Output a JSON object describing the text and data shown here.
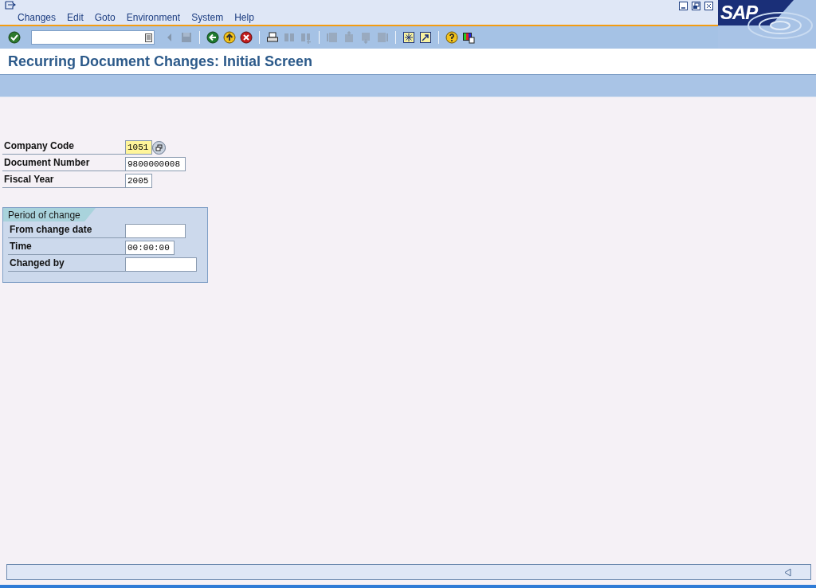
{
  "menu_bar": [
    "Changes",
    "Edit",
    "Goto",
    "Environment",
    "System",
    "Help"
  ],
  "logo": "SAP",
  "toolbar": {
    "groups": [
      [
        {
          "kind": "enter",
          "disabled": false
        }
      ],
      [
        {
          "kind": "prev",
          "disabled": true
        },
        {
          "kind": "save",
          "disabled": true
        }
      ],
      [
        {
          "kind": "back",
          "disabled": false
        },
        {
          "kind": "exit",
          "disabled": false
        },
        {
          "kind": "cancel",
          "disabled": false
        }
      ],
      [
        {
          "kind": "print",
          "disabled": false
        },
        {
          "kind": "find",
          "disabled": true
        },
        {
          "kind": "find-next",
          "disabled": true
        }
      ],
      [
        {
          "kind": "first-page",
          "disabled": true
        },
        {
          "kind": "prev-page",
          "disabled": true
        },
        {
          "kind": "next-page",
          "disabled": true
        },
        {
          "kind": "last-page",
          "disabled": true
        }
      ],
      [
        {
          "kind": "new-session",
          "disabled": false
        },
        {
          "kind": "shortcut",
          "disabled": false
        }
      ],
      [
        {
          "kind": "help",
          "disabled": false
        },
        {
          "kind": "layout",
          "disabled": false
        }
      ]
    ]
  },
  "title": "Recurring Document Changes: Initial Screen",
  "fields": [
    {
      "label": "Company Code",
      "value": "1051",
      "kind": "code",
      "focused": true,
      "search_help": true
    },
    {
      "label": "Document Number",
      "value": "9800000008",
      "kind": "number",
      "focused": false,
      "search_help": false
    },
    {
      "label": "Fiscal Year",
      "value": "2005",
      "kind": "code",
      "focused": false,
      "search_help": false
    }
  ],
  "period_group": {
    "title": "Period of change",
    "fields": [
      {
        "label": "From change date",
        "kind": "date",
        "focused": false,
        "search_help": false
      },
      {
        "label": "Time",
        "value": "00:00:00",
        "kind": "time",
        "focused": false,
        "search_help": false
      },
      {
        "label": "Changed by",
        "kind": "user",
        "focused": false,
        "search_help": false
      }
    ]
  }
}
